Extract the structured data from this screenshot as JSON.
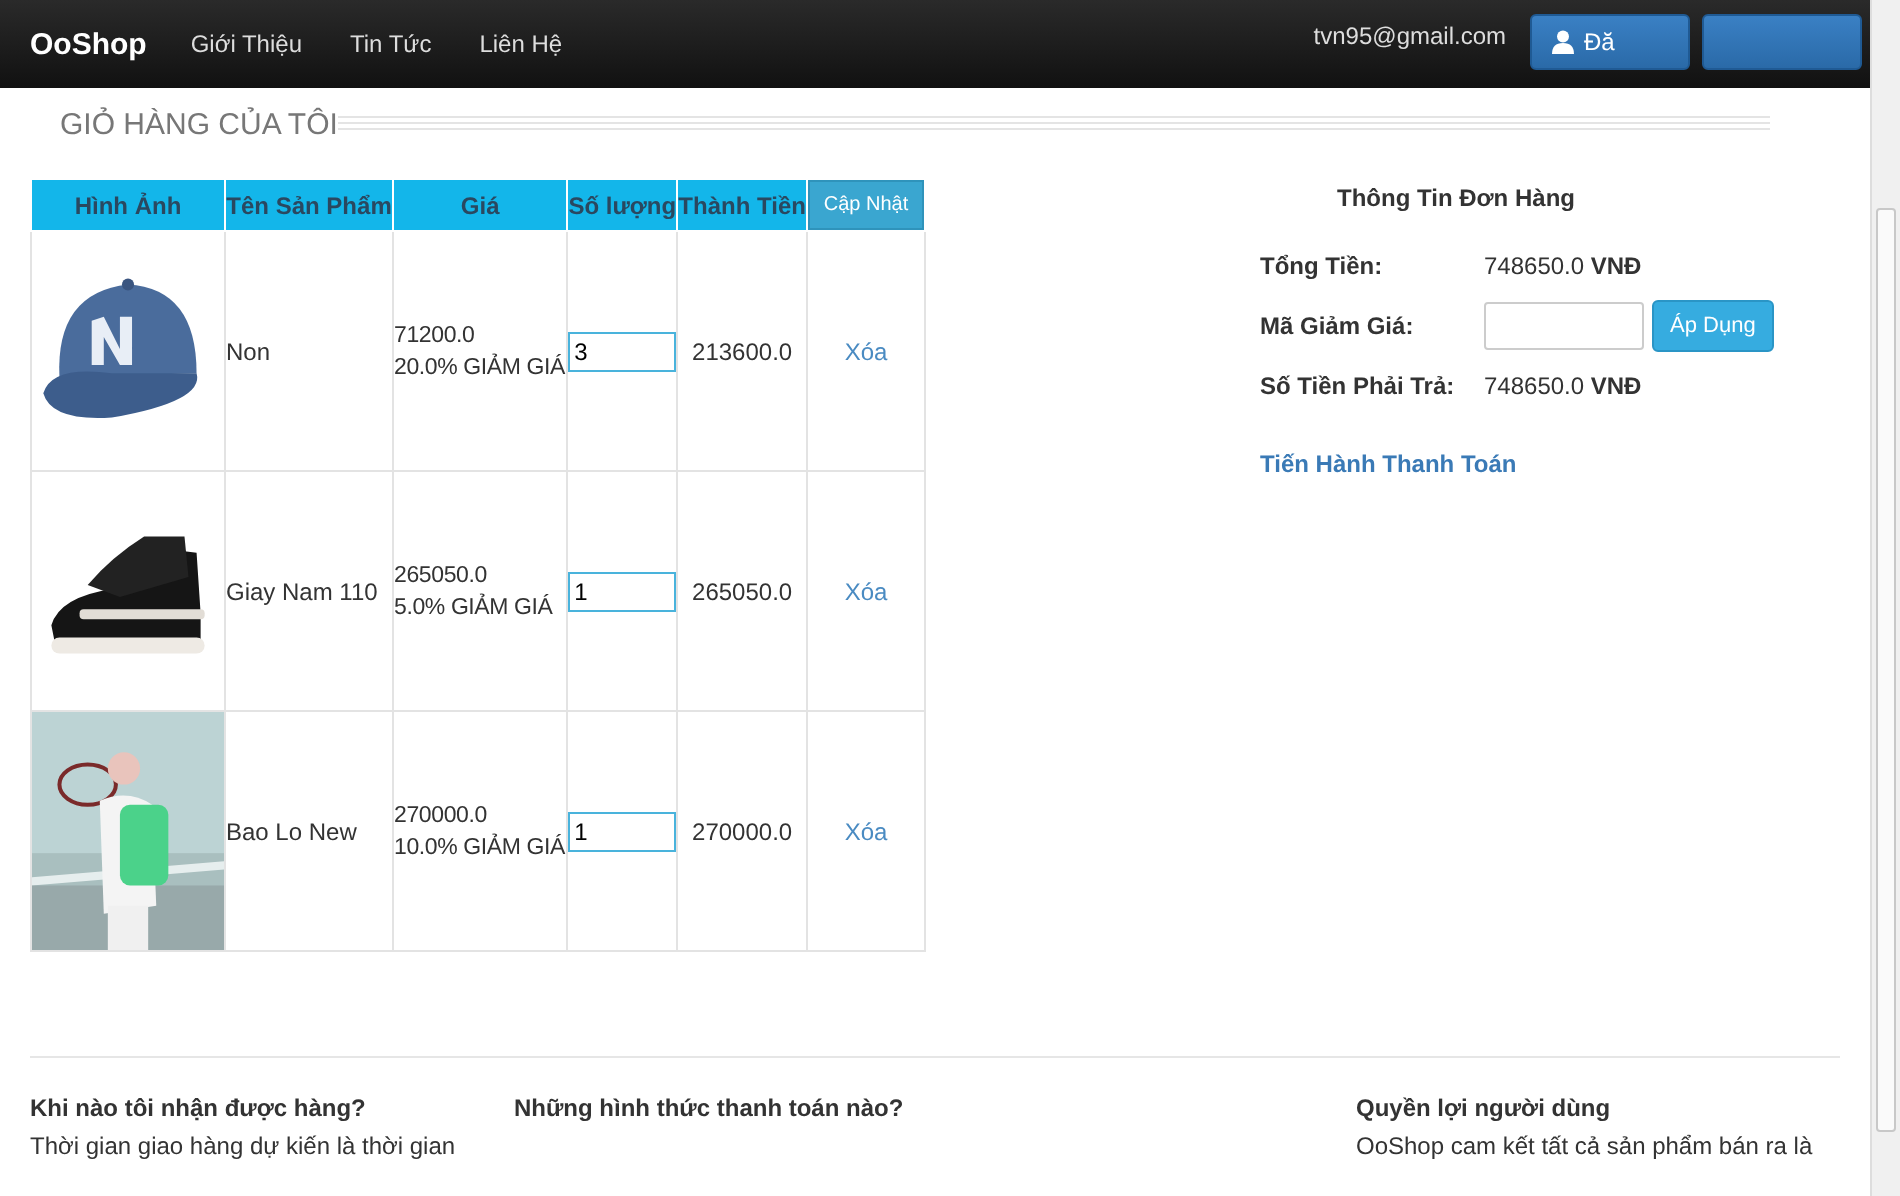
{
  "navbar": {
    "brand": "OoShop",
    "links": [
      "Giới Thiệu",
      "Tin Tức",
      "Liên Hệ"
    ],
    "email": "tvn95@gmail.com",
    "buttons": [
      {
        "kind": "user",
        "label": "Đă"
      },
      {
        "kind": "plain"
      }
    ]
  },
  "page_title": "GIỎ HÀNG CỦA TÔI",
  "cart": {
    "columns": [
      "Hình Ảnh",
      "Tên Sản Phẩm",
      "Giá",
      "Số lượng",
      "Thành Tiền"
    ],
    "update_button": "Cập Nhật",
    "rows": [
      {
        "image": {
          "kind": "cap"
        },
        "name": "Non",
        "price": "71200.0",
        "discount": "20.0% GIẢM GIÁ",
        "quantity": "3",
        "total": "213600.0",
        "remove": "Xóa"
      },
      {
        "image": {
          "kind": "shoe"
        },
        "name": "Giay Nam 110",
        "price": "265050.0",
        "discount": "5.0% GIẢM GIÁ",
        "quantity": "1",
        "total": "265050.0",
        "remove": "Xóa"
      },
      {
        "name": "Bao Lo New",
        "price": "270000.0",
        "discount": "10.0% GIẢM GIÁ",
        "quantity": "1",
        "total": "270000.0",
        "remove": "Xóa"
      }
    ]
  },
  "order": {
    "title": "Thông Tin Đơn Hàng",
    "total_label": "Tổng Tiền:",
    "total_value": "748650.0",
    "total_currency": "VNĐ",
    "coupon_label": "Mã Giảm Giá:",
    "apply_button": "Áp Dụng",
    "pay_label": "Số Tiền Phải Trả:",
    "pay_value": "748650.0",
    "pay_currency": "VNĐ",
    "checkout_link": "Tiến Hành Thanh Toán"
  },
  "footer": [
    {
      "heading": "Khi nào tôi nhận được hàng?",
      "text": "Thời gian giao hàng dự kiến là thời gian"
    },
    {
      "heading": "Những hình thức thanh toán nào?"
    },
    {
      "heading": "Quyền lợi người dùng",
      "text": "OoShop cam kết tất cả sản phẩm bán ra là"
    }
  ]
}
